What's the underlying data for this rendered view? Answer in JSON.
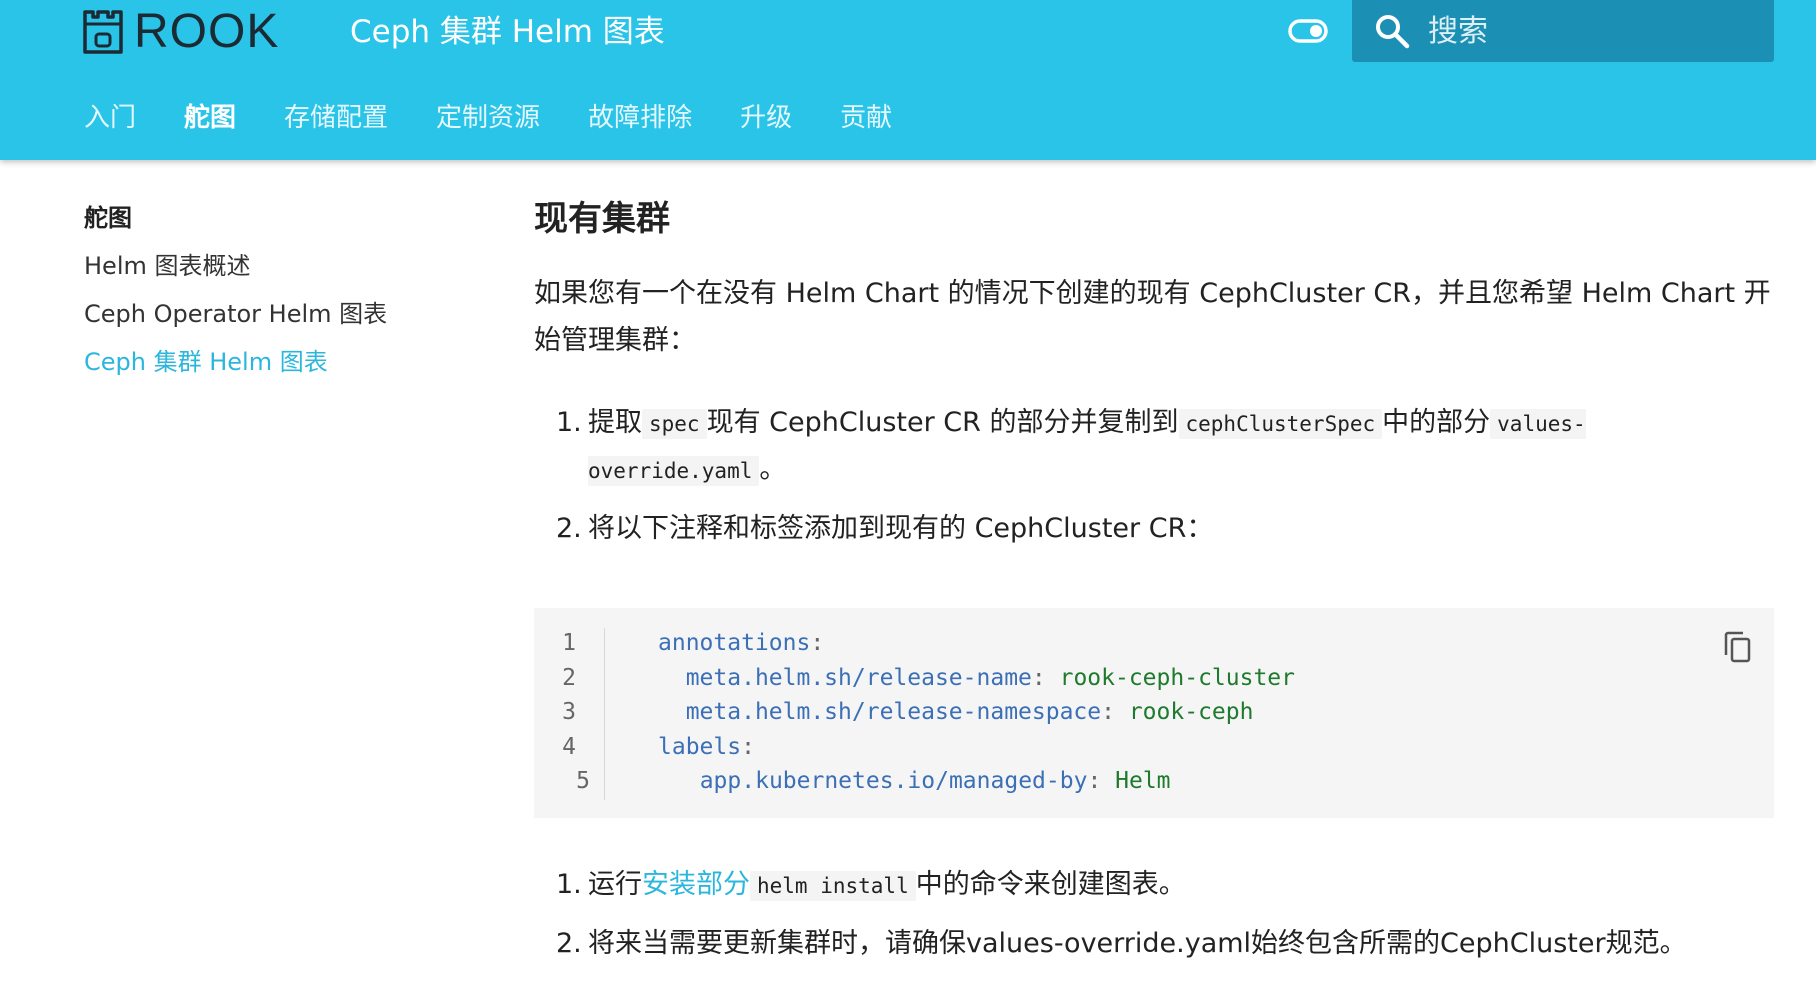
{
  "header": {
    "logo_text": "ROOK",
    "site_title": "Ceph 集群 Helm 图表",
    "search_placeholder": "搜索"
  },
  "nav": {
    "items": [
      {
        "label": "入门"
      },
      {
        "label": "舵图"
      },
      {
        "label": "存储配置"
      },
      {
        "label": "定制资源"
      },
      {
        "label": "故障排除"
      },
      {
        "label": "升级"
      },
      {
        "label": "贡献"
      }
    ],
    "active_index": 1
  },
  "sidebar": {
    "title": "舵图",
    "items": [
      {
        "label": "Helm 图表概述"
      },
      {
        "label": "Ceph Operator Helm 图表"
      },
      {
        "label": "Ceph 集群 Helm 图表"
      }
    ],
    "active_index": 2
  },
  "content": {
    "heading": "现有集群",
    "intro": "如果您有一个在没有 Helm Chart 的情况下创建的现有 CephCluster CR，并且您希望 Helm Chart 开始管理集群：",
    "steps_a": {
      "s1_num": "1.",
      "s1_t1": "提取",
      "s1_c1": "spec",
      "s1_t2": "现有 CephCluster CR 的部分并复制到",
      "s1_c2": "cephClusterSpec",
      "s1_t3": "中的部分",
      "s1_c3": "values-override.yaml",
      "s1_t4": "。",
      "s2_num": "2.",
      "s2_text": "将以下注释和标签添加到现有的 CephCluster CR："
    },
    "code": {
      "lines": [
        {
          "n": "1",
          "key": "annotations",
          "value": ""
        },
        {
          "n": "2",
          "key": "meta.helm.sh/release-name",
          "value": "rook-ceph-cluster"
        },
        {
          "n": "3",
          "key": "meta.helm.sh/release-namespace",
          "value": "rook-ceph"
        },
        {
          "n": "4",
          "key": "labels",
          "value": ""
        },
        {
          "n": "5",
          "key": "app.kubernetes.io/managed-by",
          "value": "Helm"
        }
      ]
    },
    "steps_b": {
      "s1_num": "1.",
      "s1_t1": "运行",
      "s1_link": "安装部分",
      "s1_code": "helm install",
      "s1_t2": "中的命令来创建图表。",
      "s2_num": "2.",
      "s2_text": "将来当需要更新集群时，请确保values-override.yaml始终包含所需的CephCluster规范。"
    }
  },
  "colors": {
    "header_bg": "#2bc4e9",
    "search_bg": "#1b8fb4",
    "accent": "#2bb7dd"
  },
  "icons": {
    "logo": "rook-castle-icon",
    "toggle": "toggle-icon",
    "search": "search-icon",
    "copy": "copy-icon"
  }
}
